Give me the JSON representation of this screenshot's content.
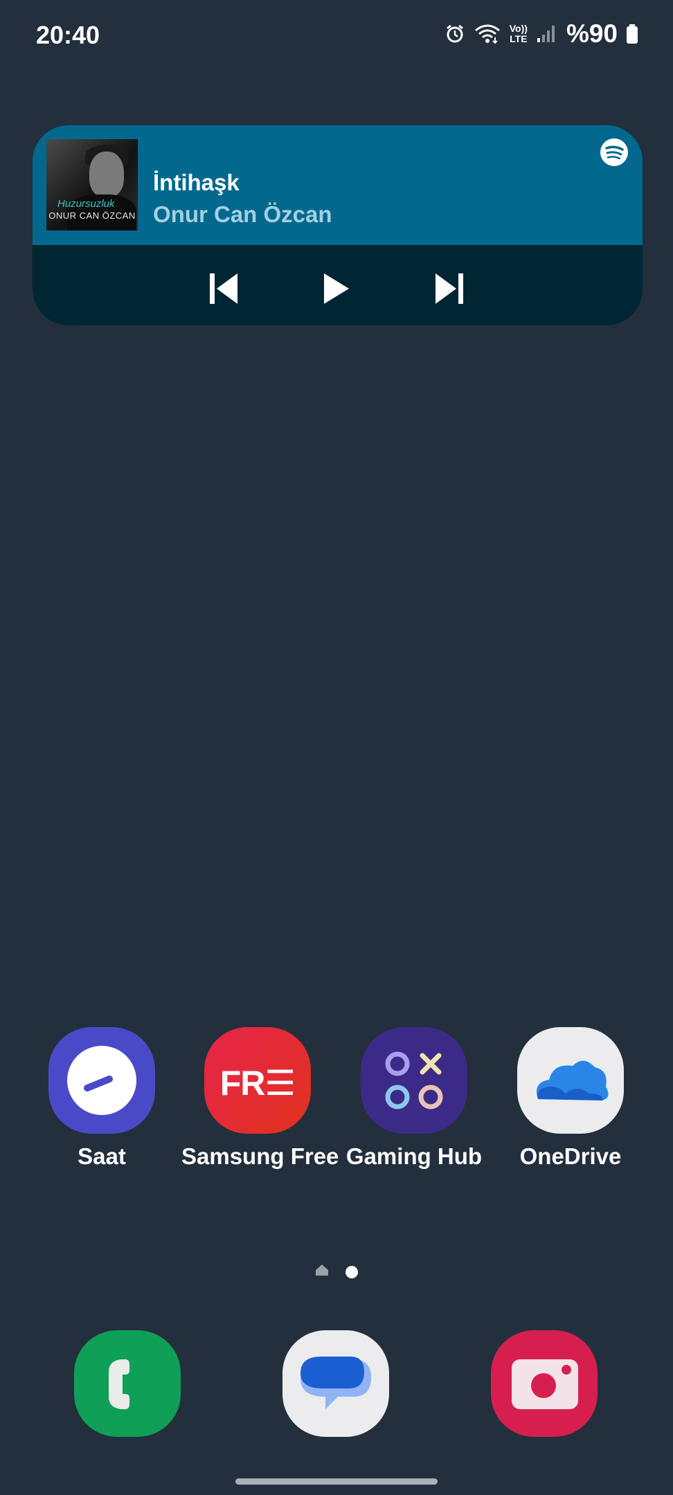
{
  "status_bar": {
    "time": "20:40",
    "volte_top": "Vo))",
    "volte_bottom": "LTE",
    "battery": "%90",
    "icons": [
      "alarm-icon",
      "wifi-icon",
      "volte-icon",
      "signal-icon",
      "battery-icon"
    ]
  },
  "media_widget": {
    "album_art_caption": "ONUR CAN ÖZCAN",
    "album_art_script": "Huzursuzluk",
    "title": "İntihaşk",
    "artist": "Onur Can Özcan",
    "colors": {
      "header": "#03688e",
      "controls_bg": "#012633"
    },
    "controls": [
      "previous-icon",
      "play-icon",
      "next-icon"
    ],
    "source_icon": "spotify-icon"
  },
  "apps": [
    {
      "label": "Saat",
      "icon": "clock-icon",
      "color": "#4a4ac8"
    },
    {
      "label": "Samsung Free",
      "icon": "free-icon",
      "color": "#e8244a",
      "icon_text": "FR☰"
    },
    {
      "label": "Gaming Hub",
      "icon": "gaming-hub-icon",
      "color": "#3c2a88"
    },
    {
      "label": "OneDrive",
      "icon": "cloud-icon",
      "color": "#ececef"
    }
  ],
  "pager": {
    "pages": [
      "home-indicator",
      "page-2"
    ],
    "active_index": 1
  },
  "dock": [
    {
      "name": "phone",
      "icon": "phone-icon",
      "color": "#0f9f57"
    },
    {
      "name": "messages",
      "icon": "message-icon",
      "color": "#ececef"
    },
    {
      "name": "camera",
      "icon": "camera-icon",
      "color": "#d61f4f"
    }
  ]
}
